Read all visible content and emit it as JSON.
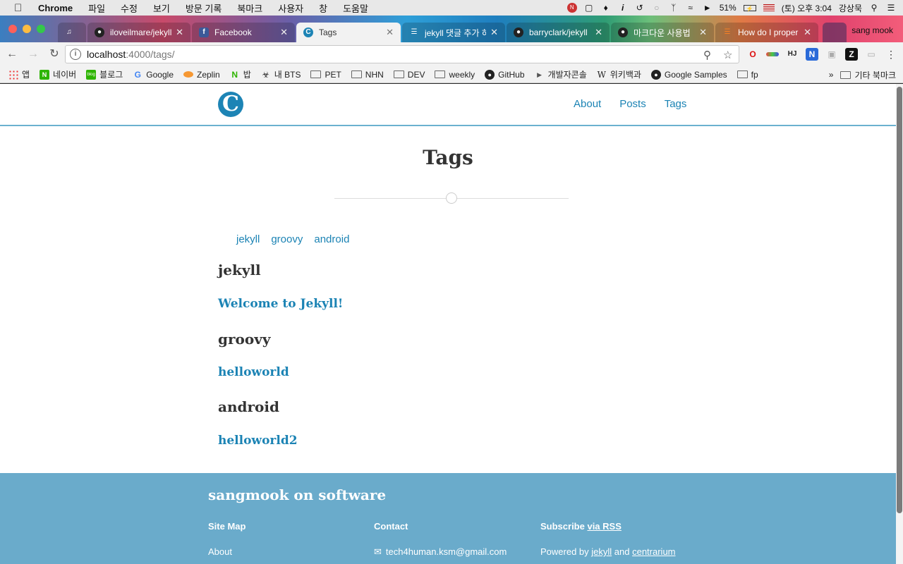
{
  "menubar": {
    "apple": "",
    "app": "Chrome",
    "items": [
      "파일",
      "수정",
      "보기",
      "방문 기록",
      "북마크",
      "사용자",
      "창",
      "도움말"
    ],
    "battery": "51%",
    "datetime": "(토) 오후 3:04",
    "user": "강상묵"
  },
  "tabs": [
    {
      "title": "",
      "icon": "speaker-icon"
    },
    {
      "title": "iloveilmare/jekyll",
      "icon": "github-icon"
    },
    {
      "title": "Facebook",
      "icon": "facebook-icon"
    },
    {
      "title": "Tags",
      "icon": "centrarium-icon"
    },
    {
      "title": "jekyll 댓글 추가 하",
      "icon": "doc-icon"
    },
    {
      "title": "barryclark/jekyll",
      "icon": "github-icon"
    },
    {
      "title": "마크다운 사용법",
      "icon": "github-icon"
    },
    {
      "title": "How do I proper",
      "icon": "stackoverflow-icon"
    }
  ],
  "profile": "sang mook",
  "address": {
    "host": "localhost",
    "path": ":4000/tags/"
  },
  "bookmarks": {
    "items": [
      {
        "label": "앱",
        "icon": "apps-grid-icon"
      },
      {
        "label": "네이버",
        "icon": "naver-icon"
      },
      {
        "label": "블로그",
        "icon": "blog-icon"
      },
      {
        "label": "Google",
        "icon": "google-icon"
      },
      {
        "label": "Zeplin",
        "icon": "zeplin-icon"
      },
      {
        "label": "밥",
        "icon": "naver-icon"
      },
      {
        "label": "내 BTS",
        "icon": "bts-icon"
      },
      {
        "label": "PET",
        "icon": "folder-icon"
      },
      {
        "label": "NHN",
        "icon": "folder-icon"
      },
      {
        "label": "DEV",
        "icon": "folder-icon"
      },
      {
        "label": "weekly",
        "icon": "folder-icon"
      },
      {
        "label": "GitHub",
        "icon": "github-icon"
      },
      {
        "label": "개발자콘솔",
        "icon": "play-icon"
      },
      {
        "label": "위키백과",
        "icon": "wikipedia-icon"
      },
      {
        "label": "Google Samples",
        "icon": "github-icon"
      },
      {
        "label": "fp",
        "icon": "folder-icon"
      }
    ],
    "more": "»",
    "other": "기타 북마크"
  },
  "site": {
    "logo_letter": "C",
    "nav": [
      "About",
      "Posts",
      "Tags"
    ],
    "page_title": "Tags",
    "tag_links": [
      "jekyll",
      "groovy",
      "android"
    ],
    "sections": [
      {
        "tag": "jekyll",
        "post": "Welcome to Jekyll!"
      },
      {
        "tag": "groovy",
        "post": "helloworld"
      },
      {
        "tag": "android",
        "post": "helloworld2"
      }
    ]
  },
  "footer": {
    "brand": "sangmook on software",
    "sitemap_heading": "Site Map",
    "contact_heading": "Contact",
    "subscribe_heading": "Subscribe ",
    "subscribe_link": "via RSS",
    "sitemap_link": "About",
    "email": "tech4human.ksm@gmail.com",
    "powered_prefix": "Powered by ",
    "powered_jekyll": "jekyll",
    "powered_and": " and ",
    "powered_theme": "centrarium"
  },
  "colors": {
    "link": "#1b83b4",
    "footer_bg": "#6aabcb",
    "logo_bg": "#1d84b5"
  }
}
